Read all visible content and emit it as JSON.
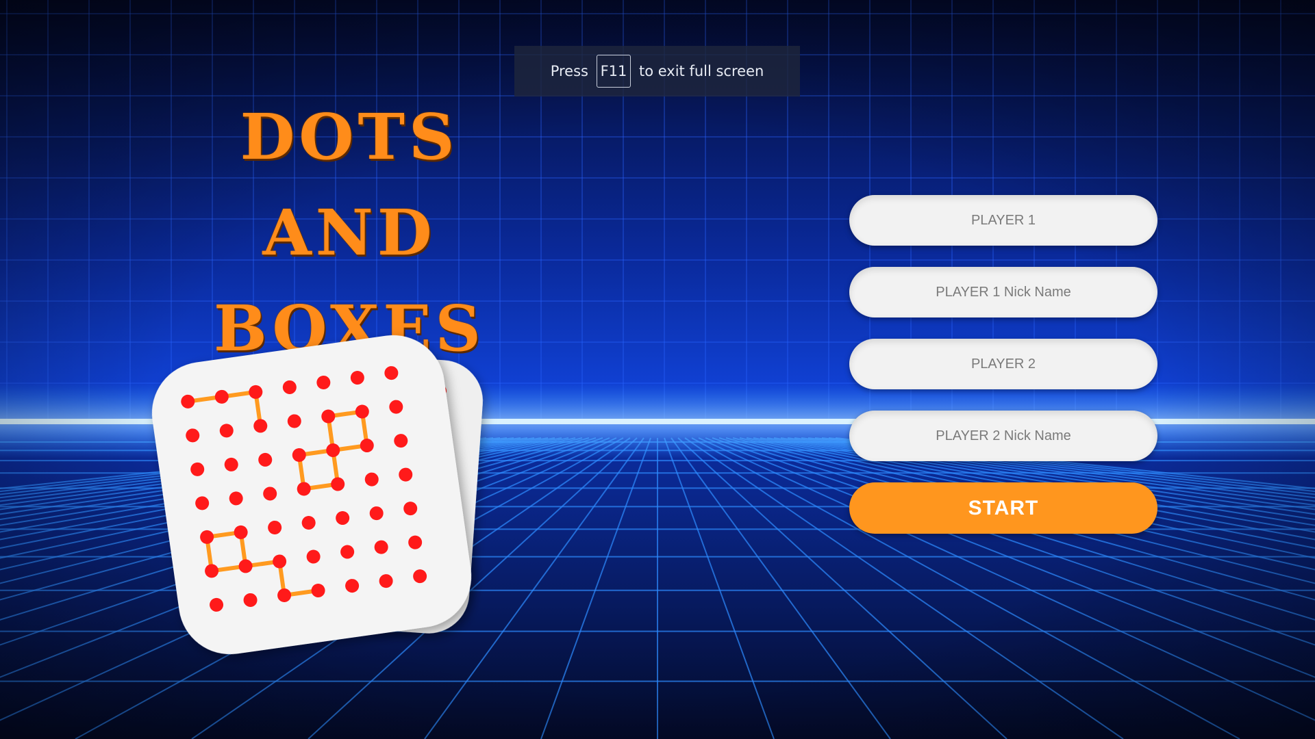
{
  "fullscreen_notice": {
    "before": "Press",
    "key": "F11",
    "after": "to exit full screen"
  },
  "title": {
    "line1": "DOTS AND",
    "line2": "BOXES"
  },
  "form": {
    "player1_placeholder": "PLAYER 1",
    "player1_nick_placeholder": "PLAYER 1 Nick Name",
    "player2_placeholder": "PLAYER 2",
    "player2_nick_placeholder": "PLAYER 2 Nick Name",
    "start_label": "START"
  },
  "colors": {
    "background": "#05103a",
    "grid_line": "#1f5bff",
    "horizon_glow": "#3fb4ff",
    "title": "#ff8c1a",
    "start_button": "#ff961e",
    "dot": "#ff1a1a",
    "box_line": "#ff9a1f",
    "card": "#f4f4f4"
  }
}
